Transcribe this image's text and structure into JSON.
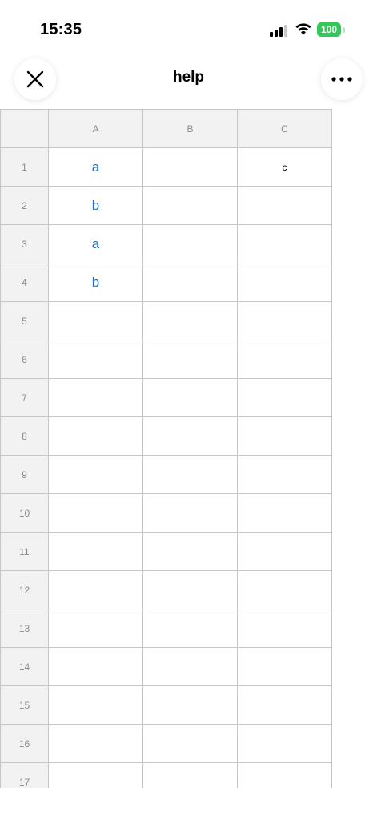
{
  "status_bar": {
    "time": "15:35",
    "battery_level": "100",
    "icons": [
      "cellular-signal-icon",
      "wifi-icon",
      "battery-icon"
    ]
  },
  "header": {
    "title": "help",
    "close_icon": "close-icon",
    "more_icon": "more-horizontal-icon"
  },
  "sheet": {
    "columns": [
      "A",
      "B",
      "C"
    ],
    "rows": [
      {
        "num": "1",
        "cells": [
          "a",
          "",
          "c"
        ]
      },
      {
        "num": "2",
        "cells": [
          "b",
          "",
          ""
        ]
      },
      {
        "num": "3",
        "cells": [
          "a",
          "",
          ""
        ]
      },
      {
        "num": "4",
        "cells": [
          "b",
          "",
          ""
        ]
      },
      {
        "num": "5",
        "cells": [
          "",
          "",
          ""
        ]
      },
      {
        "num": "6",
        "cells": [
          "",
          "",
          ""
        ]
      },
      {
        "num": "7",
        "cells": [
          "",
          "",
          ""
        ]
      },
      {
        "num": "8",
        "cells": [
          "",
          "",
          ""
        ]
      },
      {
        "num": "9",
        "cells": [
          "",
          "",
          ""
        ]
      },
      {
        "num": "10",
        "cells": [
          "",
          "",
          ""
        ]
      },
      {
        "num": "11",
        "cells": [
          "",
          "",
          ""
        ]
      },
      {
        "num": "12",
        "cells": [
          "",
          "",
          ""
        ]
      },
      {
        "num": "13",
        "cells": [
          "",
          "",
          ""
        ]
      },
      {
        "num": "14",
        "cells": [
          "",
          "",
          ""
        ]
      },
      {
        "num": "15",
        "cells": [
          "",
          "",
          ""
        ]
      },
      {
        "num": "16",
        "cells": [
          "",
          "",
          ""
        ]
      },
      {
        "num": "17",
        "cells": [
          "",
          "",
          ""
        ]
      }
    ]
  },
  "colors": {
    "accent_text": "#1a73c9",
    "battery_green": "#34c759",
    "header_fill": "#f2f2f2",
    "grid_line": "#c6c6c6"
  }
}
